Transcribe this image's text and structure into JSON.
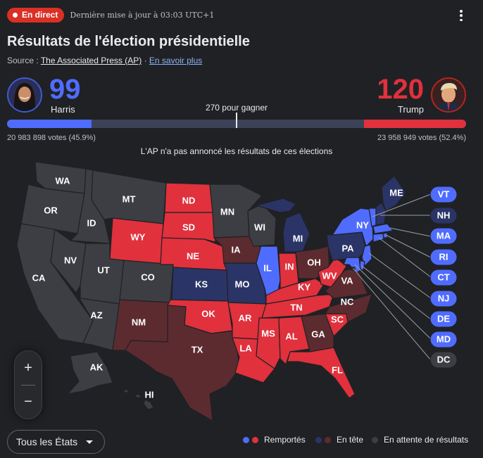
{
  "header": {
    "live_label": "En direct",
    "update_text": "Dernière mise à jour à 03:03 UTC+1",
    "title": "Résultats de l'élection présidentielle",
    "source_prefix": "Source :",
    "source_link": "The Associated Press (AP)",
    "source_sep": "·",
    "more_link": "En savoir plus"
  },
  "harris": {
    "name": "Harris",
    "electoral_votes": "99",
    "votes_text": "20 983 898 votes (45.9%)",
    "color": "#4f6cff"
  },
  "trump": {
    "name": "Trump",
    "electoral_votes": "120",
    "votes_text": "23 958 949 votes (52.4%)",
    "color": "#e0313d"
  },
  "bar": {
    "to_win_label": "270 pour gagner",
    "total_votes": 538,
    "threshold": 270,
    "harris_value": 99,
    "trump_value": 120
  },
  "ap_note": "L'AP n'a pas annoncé les résultats de ces élections",
  "colors": {
    "dem_won": "#4f6cff",
    "rep_won": "#e0313d",
    "dem_lead": "#2b3466",
    "rep_lead": "#5c2b30",
    "pending": "#3c3e44"
  },
  "map": {
    "states": [
      {
        "id": "WA",
        "status": "pending"
      },
      {
        "id": "OR",
        "status": "pending"
      },
      {
        "id": "CA",
        "status": "pending"
      },
      {
        "id": "ID",
        "status": "pending"
      },
      {
        "id": "NV",
        "status": "pending"
      },
      {
        "id": "MT",
        "status": "pending"
      },
      {
        "id": "UT",
        "status": "pending"
      },
      {
        "id": "AZ",
        "status": "pending"
      },
      {
        "id": "CO",
        "status": "pending"
      },
      {
        "id": "WY",
        "status": "rep_won"
      },
      {
        "id": "NM",
        "status": "rep_lead"
      },
      {
        "id": "ND",
        "status": "rep_won"
      },
      {
        "id": "SD",
        "status": "rep_won"
      },
      {
        "id": "NE",
        "status": "rep_won"
      },
      {
        "id": "KS",
        "status": "dem_lead"
      },
      {
        "id": "OK",
        "status": "rep_won"
      },
      {
        "id": "TX",
        "status": "rep_lead"
      },
      {
        "id": "MN",
        "status": "pending"
      },
      {
        "id": "IA",
        "status": "rep_lead"
      },
      {
        "id": "MO",
        "status": "dem_lead"
      },
      {
        "id": "AR",
        "status": "rep_won"
      },
      {
        "id": "LA",
        "status": "rep_won"
      },
      {
        "id": "WI",
        "status": "pending"
      },
      {
        "id": "IL",
        "status": "dem_won"
      },
      {
        "id": "MI",
        "status": "dem_lead"
      },
      {
        "id": "IN",
        "status": "rep_won"
      },
      {
        "id": "OH",
        "status": "rep_lead"
      },
      {
        "id": "KY",
        "status": "rep_won"
      },
      {
        "id": "TN",
        "status": "rep_won"
      },
      {
        "id": "MS",
        "status": "rep_won"
      },
      {
        "id": "AL",
        "status": "rep_won"
      },
      {
        "id": "GA",
        "status": "rep_lead"
      },
      {
        "id": "FL",
        "status": "rep_won"
      },
      {
        "id": "SC",
        "status": "rep_won"
      },
      {
        "id": "NC",
        "status": "rep_lead"
      },
      {
        "id": "VA",
        "status": "rep_lead"
      },
      {
        "id": "WV",
        "status": "rep_won"
      },
      {
        "id": "PA",
        "status": "dem_lead"
      },
      {
        "id": "NY",
        "status": "dem_won"
      },
      {
        "id": "ME",
        "status": "dem_lead"
      },
      {
        "id": "AK",
        "status": "pending"
      },
      {
        "id": "HI",
        "status": "pending"
      }
    ],
    "small_states": [
      {
        "id": "VT",
        "status": "dem_won"
      },
      {
        "id": "NH",
        "status": "dem_lead"
      },
      {
        "id": "MA",
        "status": "dem_won"
      },
      {
        "id": "RI",
        "status": "dem_won"
      },
      {
        "id": "CT",
        "status": "dem_won"
      },
      {
        "id": "NJ",
        "status": "dem_won"
      },
      {
        "id": "DE",
        "status": "dem_won"
      },
      {
        "id": "MD",
        "status": "dem_won"
      },
      {
        "id": "DC",
        "status": "pending"
      }
    ]
  },
  "zoom": {
    "plus": "+",
    "minus": "−"
  },
  "filter": {
    "selected": "Tous les États"
  },
  "legend": {
    "won": "Remportés",
    "lead": "En tête",
    "pending": "En attente de résultats"
  },
  "icons": {
    "menu": "more-vert-icon",
    "zoom_in": "plus-icon",
    "zoom_out": "minus-icon",
    "dropdown": "caret-down-icon"
  }
}
